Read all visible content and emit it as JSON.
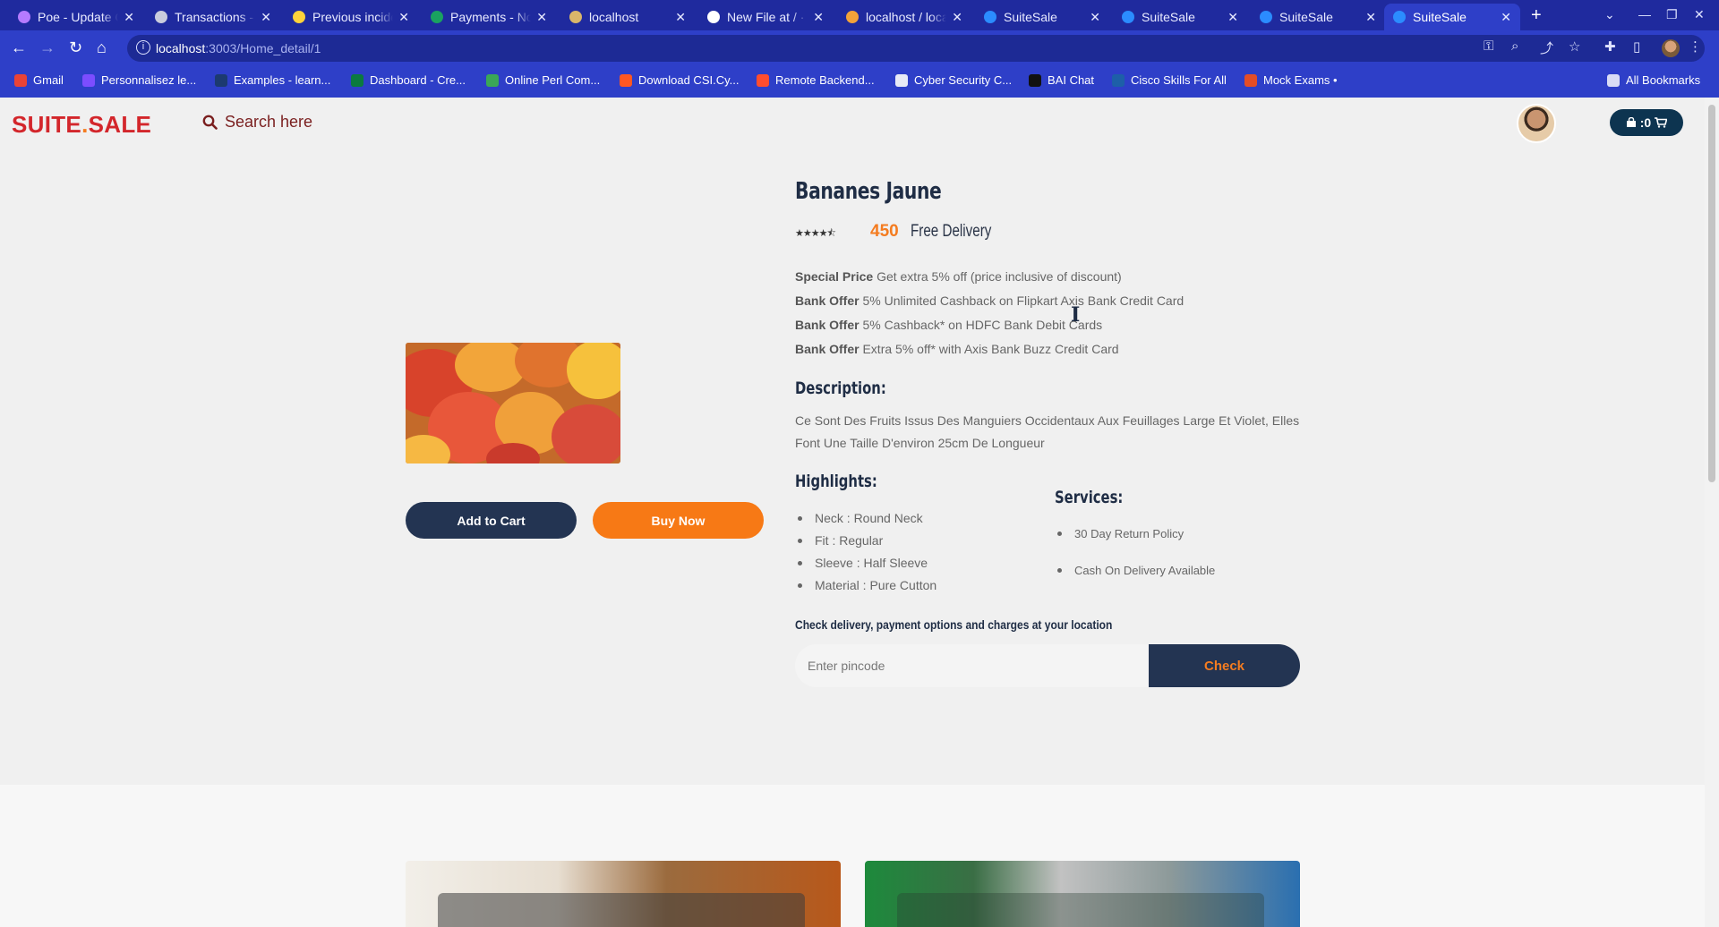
{
  "browser": {
    "tabs": [
      {
        "title": "Poe - Update C",
        "color": "#b57bff"
      },
      {
        "title": "Transactions -",
        "color": "#c9ccdd"
      },
      {
        "title": "Previous incide",
        "color": "#ffd23b"
      },
      {
        "title": "Payments - No",
        "color": "#1aa260"
      },
      {
        "title": "localhost",
        "color": "#d9b66a"
      },
      {
        "title": "New File at / ·",
        "color": "#ffffff"
      },
      {
        "title": "localhost / loca",
        "color": "#f2a23a"
      },
      {
        "title": "SuiteSale",
        "color": "#2b8cff"
      },
      {
        "title": "SuiteSale",
        "color": "#2b8cff"
      },
      {
        "title": "SuiteSale",
        "color": "#2b8cff"
      },
      {
        "title": "SuiteSale",
        "color": "#2b8cff",
        "active": true
      }
    ],
    "new_tab": "+",
    "url_host": "localhost",
    "url_path": ":3003/Home_detail/1",
    "bookmarks": [
      {
        "label": "Gmail",
        "color": "#ea4335"
      },
      {
        "label": "Personnalisez le...",
        "color": "#7c4dff"
      },
      {
        "label": "Examples - learn...",
        "color": "#1c3a70"
      },
      {
        "label": "Dashboard - Cre...",
        "color": "#0b7a3f"
      },
      {
        "label": "Online Perl Com...",
        "color": "#3aa757"
      },
      {
        "label": "Download CSI.Cy...",
        "color": "#ff5722"
      },
      {
        "label": "Remote Backend...",
        "color": "#ff4d2e"
      },
      {
        "label": "Cyber Security C...",
        "color": "#e8eaf6"
      },
      {
        "label": "BAI Chat",
        "color": "#111111"
      },
      {
        "label": "Cisco Skills For All",
        "color": "#1d5fa8"
      },
      {
        "label": "Mock Exams •",
        "color": "#e44d26"
      }
    ],
    "all_bookmarks": "All Bookmarks"
  },
  "header": {
    "logo_main": "SUITE",
    "logo_dot": ".",
    "logo_tail": "SALE",
    "search_label": "Search here",
    "cart_count": ":0"
  },
  "product": {
    "title": "Bananes Jaune",
    "rating": 4.5,
    "stars_glyph": "★★★★⯪",
    "price": "450",
    "delivery": "Free Delivery",
    "offers": [
      {
        "label": "Special Price",
        "text": "Get extra 5% off (price inclusive of discount)"
      },
      {
        "label": "Bank Offer",
        "text": "5% Unlimited Cashback on Flipkart Axis Bank Credit Card"
      },
      {
        "label": "Bank Offer",
        "text": "5% Cashback* on HDFC Bank Debit Cards"
      },
      {
        "label": "Bank Offer",
        "text": "Extra 5% off* with Axis Bank Buzz Credit Card"
      }
    ],
    "description_title": "Description:",
    "description": "Ce Sont Des Fruits Issus Des Manguiers Occidentaux Aux Feuillages Large Et Violet, Elles Font Une Taille D'environ 25cm De Longueur",
    "highlights_title": "Highlights:",
    "highlights": [
      "Neck : Round Neck",
      "Fit : Regular",
      "Sleeve : Half Sleeve",
      "Material : Pure Cutton"
    ],
    "services_title": "Services:",
    "services": [
      "30 Day Return Policy",
      "Cash On Delivery Available"
    ],
    "add_to_cart": "Add to Cart",
    "buy_now": "Buy Now",
    "check_label": "Check delivery, payment options and charges at your location",
    "pincode_placeholder": "Enter pincode",
    "check_button": "Check"
  }
}
